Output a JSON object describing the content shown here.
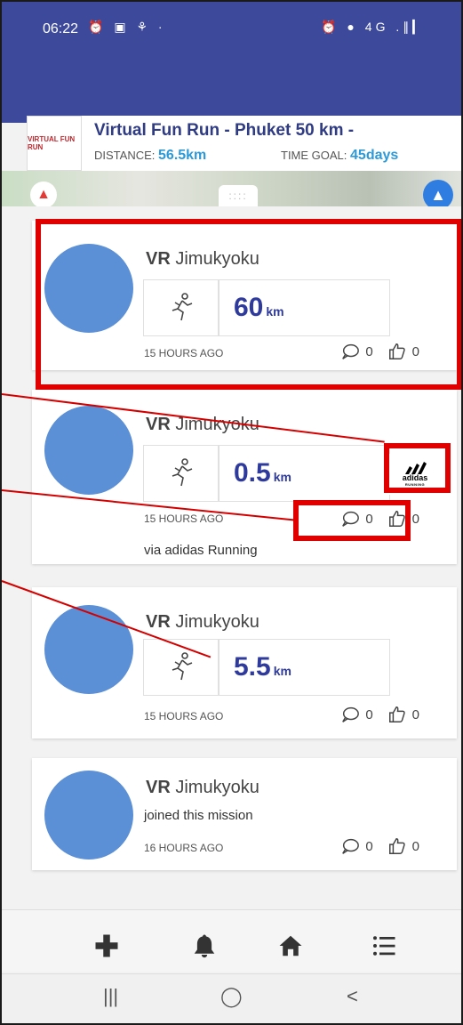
{
  "status_bar": {
    "time": "06:22",
    "left_icons": "⏰ ▣ ⚘ ·",
    "right_icons": "⏰ ● 4G .∥▎"
  },
  "mission": {
    "logo_text": "VIRTUAL FUN RUN",
    "title": "Virtual Fun Run - Phuket 50 km -",
    "distance_label": "DISTANCE:",
    "distance_value": "56.5",
    "distance_unit": "km",
    "time_goal_label": "TIME GOAL:",
    "time_goal_value": "45",
    "time_goal_unit": "days"
  },
  "map": {
    "left_btn": "▲",
    "handle": "::::",
    "right_btn": "▲"
  },
  "feed": {
    "cards": [
      {
        "user_bold": "VR",
        "user_name": "Jimukyoku",
        "distance": "60",
        "unit": "km",
        "time_ago": "15 HOURS AGO",
        "comments": "0",
        "likes": "0"
      },
      {
        "user_bold": "VR",
        "user_name": "Jimukyoku",
        "distance": "0.5",
        "unit": "km",
        "time_ago": "15 HOURS AGO",
        "comments": "0",
        "likes": "0",
        "via": "via adidas Running",
        "source_logo_text": "adidas",
        "source_logo_sub": "RUNNING"
      },
      {
        "user_bold": "VR",
        "user_name": "Jimukyoku",
        "distance": "5.5",
        "unit": "km",
        "time_ago": "15 HOURS AGO",
        "comments": "0",
        "likes": "0"
      },
      {
        "user_bold": "VR",
        "user_name": "Jimukyoku",
        "message": "joined this mission",
        "time_ago": "16 HOURS AGO",
        "comments": "0",
        "likes": "0"
      }
    ]
  },
  "bottom_nav": {
    "icons": [
      "plus-icon",
      "bell-icon",
      "home-icon",
      "list-icon"
    ]
  },
  "system_bar": {
    "recent": "|||",
    "home": "◯",
    "back": "<"
  },
  "colors": {
    "header": "#3d4a9c",
    "accent_blue": "#2c9ad8",
    "distance_text": "#2f3b9c",
    "avatar": "#5b8fd6",
    "annotation_red": "#e00000"
  }
}
